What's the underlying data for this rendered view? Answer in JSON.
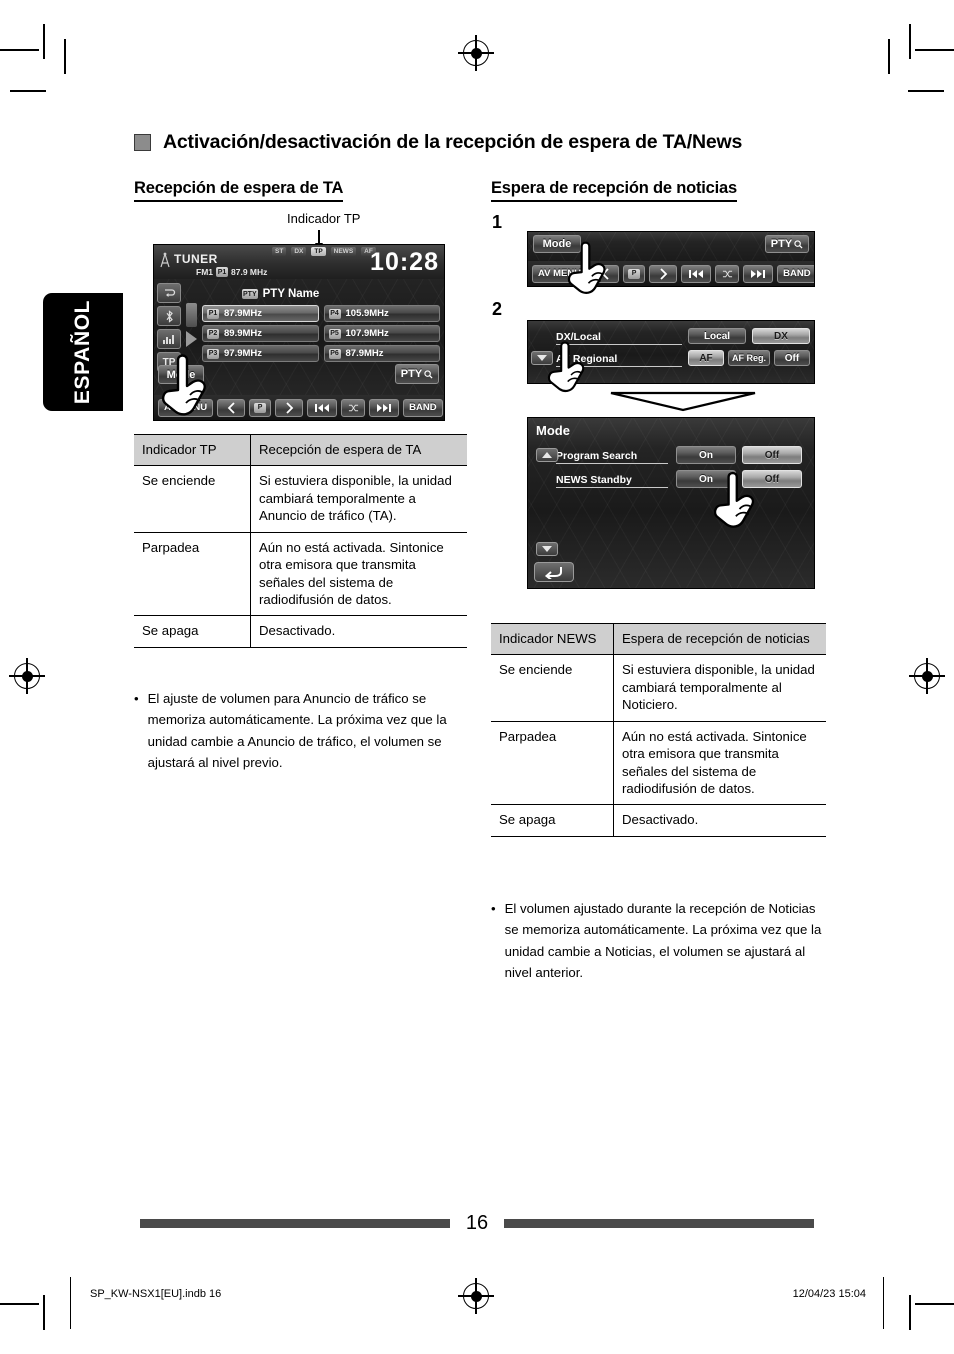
{
  "language_tab": "ESPAÑOL",
  "main_heading": "Activación/desactivación de la recepción de espera de TA/News",
  "left_column": {
    "subheading": "Recepción de espera de TA",
    "caption": "Indicador TP",
    "screen": {
      "source": "TUNER",
      "band": "FM1",
      "preset_chip": "P1",
      "frequency": "87.9 MHz",
      "clock": "10:28",
      "status_indicators": [
        "ST",
        "DX",
        "TP",
        "NEWS",
        "AF"
      ],
      "pty_chip": "PTY",
      "pty_name": "PTY Name",
      "side_icons": [
        "list-icon",
        "bluetooth-icon",
        "equalizer-icon"
      ],
      "tp_button": "TP",
      "mode_button": "Mode",
      "pty_button": "PTY",
      "presets": [
        {
          "no": "P1",
          "freq": "87.9MHz",
          "selected": true
        },
        {
          "no": "P4",
          "freq": "105.9MHz",
          "selected": false
        },
        {
          "no": "P2",
          "freq": "89.9MHz",
          "selected": false
        },
        {
          "no": "P5",
          "freq": "107.9MHz",
          "selected": false
        },
        {
          "no": "P3",
          "freq": "97.9MHz",
          "selected": false
        },
        {
          "no": "P6",
          "freq": "87.9MHz",
          "selected": false
        }
      ],
      "bottom_bar": [
        "AV MENU",
        "prev-chevron",
        "P",
        "next-chevron",
        "track-back",
        "random",
        "track-forward",
        "BAND"
      ],
      "av_menu_label": "AV MENU",
      "band_label": "BAND",
      "p_label": "P"
    },
    "table": {
      "headers": [
        "Indicador TP",
        "Recepción de espera de TA"
      ],
      "rows": [
        [
          "Se enciende",
          "Si estuviera disponible, la unidad cambiará temporalmente a Anuncio de tráfico (TA)."
        ],
        [
          "Parpadea",
          "Aún no está activada. Sintonice otra emisora que transmita señales del sistema de radiodifusión de datos."
        ],
        [
          "Se apaga",
          "Desactivado."
        ]
      ]
    },
    "note": "El ajuste de volumen para Anuncio de tráfico se memoriza automáticamente. La próxima vez que la unidad cambie a Anuncio de tráfico, el volumen se ajustará al nivel previo."
  },
  "right_column": {
    "subheading": "Espera de recepción de noticias",
    "steps": [
      "1",
      "2"
    ],
    "step1_screen": {
      "mode_button": "Mode",
      "pty_button": "PTY",
      "av_menu_label": "AV MENU",
      "band_label": "BAND",
      "p_label": "P"
    },
    "step2_screen_a": {
      "rows": [
        {
          "label": "DX/Local",
          "options": [
            {
              "text": "Local",
              "on": false
            },
            {
              "text": "DX",
              "on": true
            }
          ]
        },
        {
          "label": "AF Regional",
          "options": [
            {
              "text": "AF",
              "on": true
            },
            {
              "text": "AF Reg.",
              "on": false
            },
            {
              "text": "Off",
              "on": false
            }
          ]
        }
      ]
    },
    "step2_screen_b": {
      "title": "Mode",
      "rows": [
        {
          "label": "Program Search",
          "options": [
            {
              "text": "On",
              "on": false
            },
            {
              "text": "Off",
              "on": true
            }
          ]
        },
        {
          "label": "NEWS Standby",
          "options": [
            {
              "text": "On",
              "on": false
            },
            {
              "text": "Off",
              "on": true
            }
          ]
        }
      ],
      "return_glyph": "↰"
    },
    "table": {
      "headers": [
        "Indicador NEWS",
        "Espera de recepción de noticias"
      ],
      "rows": [
        [
          "Se enciende",
          "Si estuviera disponible, la unidad cambiará temporalmente al Noticiero."
        ],
        [
          "Parpadea",
          "Aún no está activada. Sintonice otra emisora que transmita señales del sistema de radiodifusión de datos."
        ],
        [
          "Se apaga",
          "Desactivado."
        ]
      ]
    },
    "note": "El volumen ajustado durante la recepción de Noticias se memoriza automáticamente. La próxima vez que la unidad cambie a Noticias, el volumen se ajustará al nivel anterior."
  },
  "footer": {
    "page_number": "16",
    "file_name": "SP_KW-NSX1[EU].indb   16",
    "timestamp": "12/04/23   15:04"
  },
  "bullet_glyph": "•"
}
